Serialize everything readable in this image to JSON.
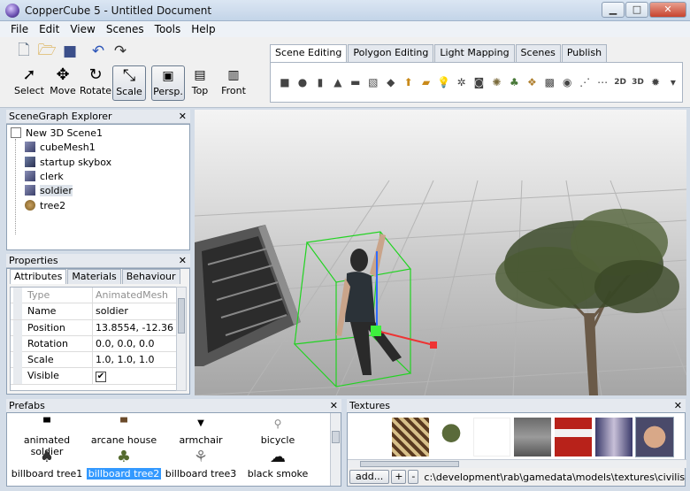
{
  "window": {
    "title": "CopperCube 5 - Untitled Document"
  },
  "menu": [
    "File",
    "Edit",
    "View",
    "Scenes",
    "Tools",
    "Help"
  ],
  "toolbar": {
    "tools": [
      "Select",
      "Move",
      "Rotate",
      "Scale",
      "Persp.",
      "Top",
      "Front"
    ],
    "tabs": [
      "Scene Editing",
      "Polygon Editing",
      "Light Mapping",
      "Scenes",
      "Publish"
    ]
  },
  "scenegraph": {
    "title": "SceneGraph Explorer",
    "root": "New 3D Scene1",
    "nodes": [
      "cubeMesh1",
      "startup skybox",
      "clerk",
      "soldier",
      "tree2"
    ]
  },
  "properties": {
    "title": "Properties",
    "tabs": [
      "Attributes",
      "Materials",
      "Behaviour"
    ],
    "rows": [
      {
        "key": "Type",
        "value": "AnimatedMesh"
      },
      {
        "key": "Name",
        "value": "soldier"
      },
      {
        "key": "Position",
        "value": "13.8554, -12.36"
      },
      {
        "key": "Rotation",
        "value": "0.0, 0.0, 0.0"
      },
      {
        "key": "Scale",
        "value": "1.0, 1.0, 1.0"
      },
      {
        "key": "Visible",
        "value": "✔"
      }
    ]
  },
  "prefabs": {
    "title": "Prefabs",
    "items": [
      "animated soldier",
      "arcane house",
      "armchair",
      "bicycle",
      "billboard tree1",
      "billboard tree2",
      "billboard tree3",
      "black smoke"
    ]
  },
  "textures": {
    "title": "Textures",
    "add_label": "add...",
    "plus": "+",
    "minus": "-",
    "path": "c:\\development\\rab\\gamedata\\models\\textures\\civilist_male_"
  }
}
